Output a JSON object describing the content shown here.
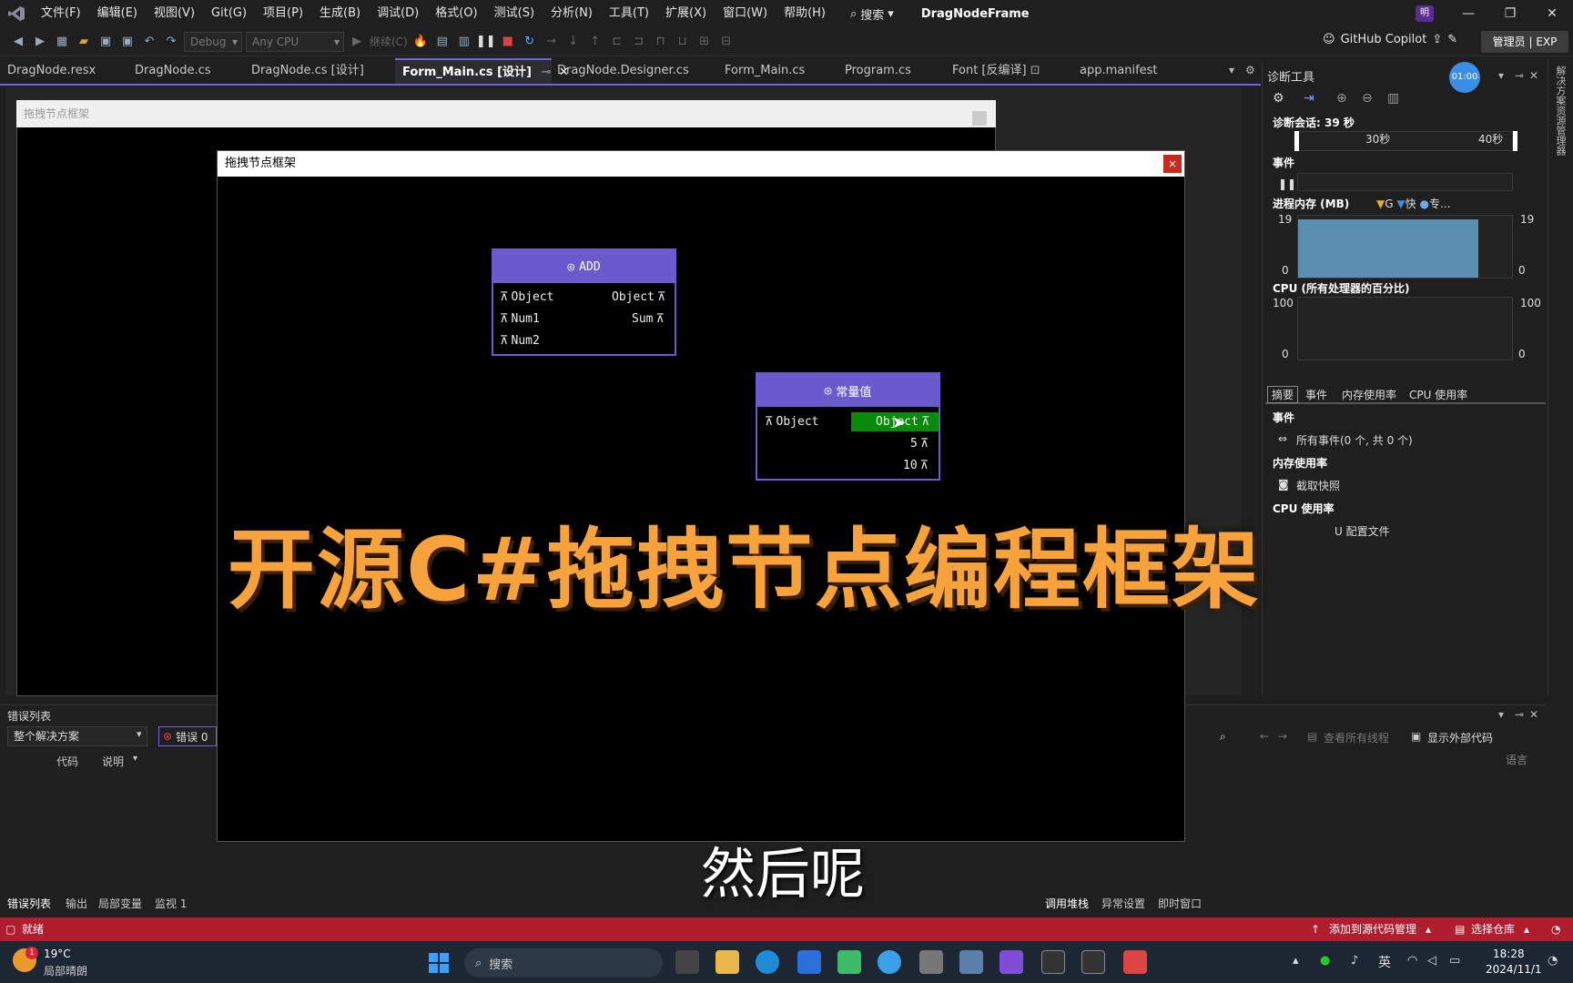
{
  "menubar": {
    "items": [
      "文件(F)",
      "编辑(E)",
      "视图(V)",
      "Git(G)",
      "项目(P)",
      "生成(B)",
      "调试(D)",
      "格式(O)",
      "测试(S)",
      "分析(N)",
      "工具(T)",
      "扩展(X)",
      "窗口(W)",
      "帮助(H)"
    ],
    "search_label": "搜索",
    "solution_name": "DragNodeFrame",
    "user_initial": "明"
  },
  "toolbar": {
    "config": "Debug",
    "platform": "Any CPU",
    "continue_label": "继续(C)",
    "copilot_label": "GitHub Copilot",
    "admin_label": "管理员 | EXP"
  },
  "tabs": [
    "DragNode.resx",
    "DragNode.cs",
    "DragNode.cs [设计]",
    "Form_Main.cs [设计]",
    "DragNode.Designer.cs",
    "Form_Main.cs",
    "Program.cs",
    "Font [反编译]",
    "app.manifest"
  ],
  "designer": {
    "form_title": "拖拽节点框架"
  },
  "diagnostics": {
    "title": "诊断工具",
    "timer": "01:00",
    "session": "诊断会话: 39 秒",
    "tick_30": "30秒",
    "tick_40": "40秒",
    "events_label": "事件",
    "memory_label": "进程内存 (MB)",
    "memory_legend": [
      "G",
      "快",
      "专..."
    ],
    "memory_max": "19",
    "memory_min": "0",
    "cpu_label": "CPU (所有处理器的百分比)",
    "cpu_max": "100",
    "cpu_min": "0",
    "tabs": [
      "摘要",
      "事件",
      "内存使用率",
      "CPU 使用率"
    ],
    "summary_events": "事件",
    "all_events": "所有事件(0 个, 共 0 个)",
    "memory_usage": "内存使用率",
    "snapshot": "截取快照",
    "cpu_usage": "CPU 使用率",
    "profile": "U 配置文件",
    "right_strip": "解决方案资源管理器"
  },
  "error_list": {
    "title": "错误列表",
    "scope": "整个解决方案",
    "errors": "错误 0",
    "col_code": "代码",
    "col_desc": "说明",
    "tabs": [
      "错误列表",
      "输出",
      "局部变量",
      "监视 1"
    ]
  },
  "call_stack": {
    "view_threads": "查看所有线程",
    "show_external": "显示外部代码",
    "lang_col": "语言",
    "tabs": [
      "调用堆栈",
      "异常设置",
      "即时窗口"
    ]
  },
  "statusbar": {
    "ready": "就绪",
    "add_source": "添加到源代码管理",
    "select_repo": "选择仓库"
  },
  "taskbar": {
    "temp": "19°C",
    "weather": "局部晴朗",
    "weather_badge": "1",
    "search": "搜索",
    "ime": "英",
    "time": "18:28",
    "date": "2024/11/1"
  },
  "dialog": {
    "title": "拖拽节点框架",
    "close": "×"
  },
  "node_add": {
    "title": "ADD",
    "in": [
      "Object",
      "Num1",
      "Num2"
    ],
    "out": [
      "Object",
      "Sum"
    ]
  },
  "node_const": {
    "title": "常量值",
    "in": [
      "Object"
    ],
    "out": [
      "Object",
      "5",
      "10"
    ]
  },
  "captions": {
    "headline": "开源C#拖拽节点编程框架",
    "subtitle": "然后呢"
  },
  "colors": {
    "node_header": "#6a5acd",
    "highlight": "#0a8a0a",
    "status_bar": "#b01d2e",
    "headline": "#f7a23a",
    "tab_accent": "#7160e8"
  }
}
